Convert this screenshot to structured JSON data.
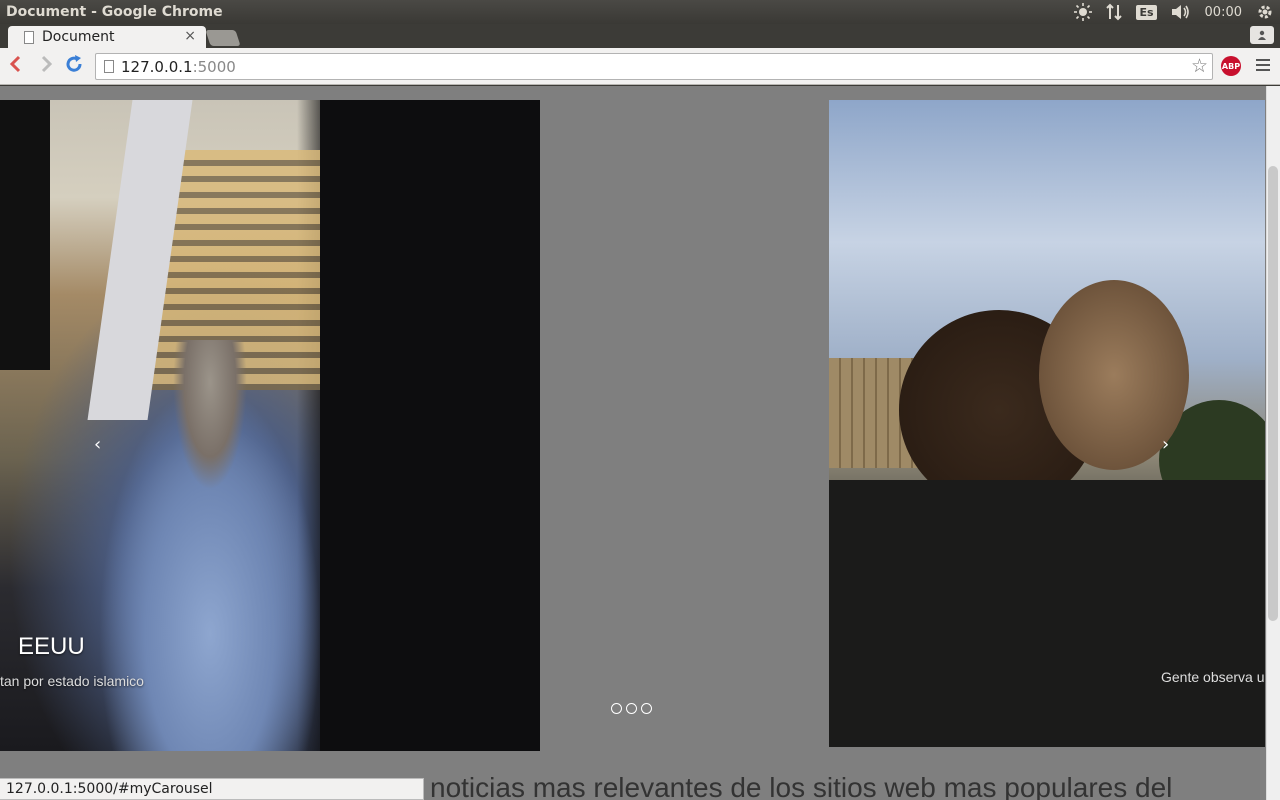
{
  "window": {
    "title": "Document - Google Chrome"
  },
  "tray": {
    "keyboard_layout": "Es",
    "clock": "00:00"
  },
  "tab": {
    "title": "Document",
    "close": "×"
  },
  "address_bar": {
    "host": "127.0.0.1",
    "port": ":5000"
  },
  "extensions": {
    "adblock_label": "ABP"
  },
  "carousel": {
    "left_slide": {
      "title": "EEUU",
      "caption": "tan por estado islamico"
    },
    "right_slide": {
      "caption": "Gente observa u"
    },
    "prev_control": "‹",
    "next_control": "›",
    "indicator_count": 3
  },
  "content": {
    "headline": "noticias mas relevantes de los sitios web mas populares del"
  },
  "status_bar": {
    "link_url": "127.0.0.1:5000/#myCarousel"
  },
  "colors": {
    "page_background": "#7f7f7f",
    "toolbar": "#f2f1f0",
    "abp_red": "#c8102e",
    "reload_blue": "#3a7fd6"
  }
}
